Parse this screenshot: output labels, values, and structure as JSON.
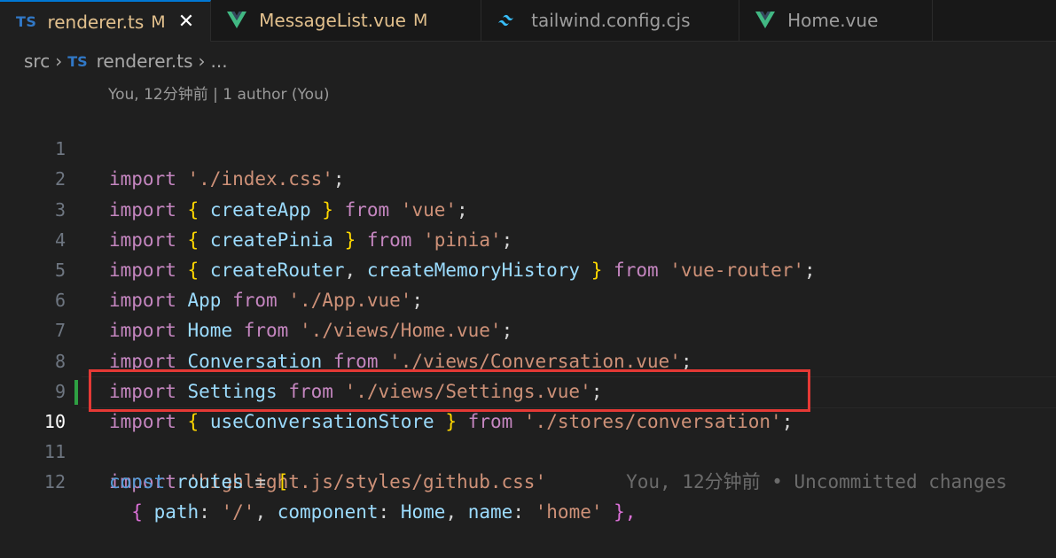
{
  "tabs": [
    {
      "icon": "ts-icon",
      "icon_text": "TS",
      "label": "renderer.ts",
      "modified_marker": "M",
      "active": true,
      "close": "✕"
    },
    {
      "icon": "vue-icon",
      "label": "MessageList.vue",
      "modified_marker": "M",
      "active": false
    },
    {
      "icon": "tailwind-icon",
      "label": "tailwind.config.cjs",
      "active": false
    },
    {
      "icon": "vue-icon",
      "label": "Home.vue",
      "active": false
    }
  ],
  "breadcrumb": {
    "folder": "src",
    "icon_text": "TS",
    "file": "renderer.ts",
    "more": "..."
  },
  "codelens": "You, 12分钟前 | 1 author (You)",
  "lines": [
    {
      "n": "1"
    },
    {
      "n": "2"
    },
    {
      "n": "3"
    },
    {
      "n": "4"
    },
    {
      "n": "5"
    },
    {
      "n": "6"
    },
    {
      "n": "7"
    },
    {
      "n": "8"
    },
    {
      "n": "9"
    },
    {
      "n": "10"
    },
    {
      "n": "11"
    },
    {
      "n": "12"
    }
  ],
  "code": {
    "l1": {
      "kw": "import",
      "str": "'./index.css'",
      "end": ";"
    },
    "l2": {
      "kw": "import",
      "open": "{",
      "id": "createApp",
      "close": "}",
      "from": "from",
      "str": "'vue'",
      "end": ";"
    },
    "l3": {
      "kw": "import",
      "open": "{",
      "id": "createPinia",
      "close": "}",
      "from": "from",
      "str": "'pinia'",
      "end": ";"
    },
    "l4": {
      "kw": "import",
      "open": "{",
      "id1": "createRouter",
      "comma": ",",
      "id2": "createMemoryHistory",
      "close": "}",
      "from": "from",
      "str": "'vue-router'",
      "end": ";"
    },
    "l5": {
      "kw": "import",
      "id": "App",
      "from": "from",
      "str": "'./App.vue'",
      "end": ";"
    },
    "l6": {
      "kw": "import",
      "id": "Home",
      "from": "from",
      "str": "'./views/Home.vue'",
      "end": ";"
    },
    "l7": {
      "kw": "import",
      "id": "Conversation",
      "from": "from",
      "str": "'./views/Conversation.vue'",
      "end": ";"
    },
    "l8": {
      "kw": "import",
      "id": "Settings",
      "from": "from",
      "str": "'./views/Settings.vue'",
      "end": ";"
    },
    "l9": {
      "kw": "import",
      "open": "{",
      "id": "useConversationStore",
      "close": "}",
      "from": "from",
      "str": "'./stores/conversation'",
      "end": ";"
    },
    "l10": {
      "kw": "import",
      "str": "'highlight.js/styles/github.css'",
      "blame": "You, 12分钟前 • Uncommitted changes"
    },
    "l11": {
      "kw": "const",
      "id": "routes",
      "op": "=",
      "open": "["
    },
    "l12": {
      "open": "{",
      "key1": "path",
      "colon1": ":",
      "str1": "'/'",
      "comma1": ",",
      "key2": "component",
      "colon2": ":",
      "val2": "Home",
      "comma2": ",",
      "key3": "name",
      "colon3": ":",
      "str3": "'home'",
      "close": "},"
    }
  },
  "colors": {
    "background": "#1f1f1f",
    "keyword": "#c586c0",
    "identifier": "#9cdcfe",
    "string": "#ce9178",
    "highlight_box": "#e53935",
    "git_added": "#2ea043"
  }
}
